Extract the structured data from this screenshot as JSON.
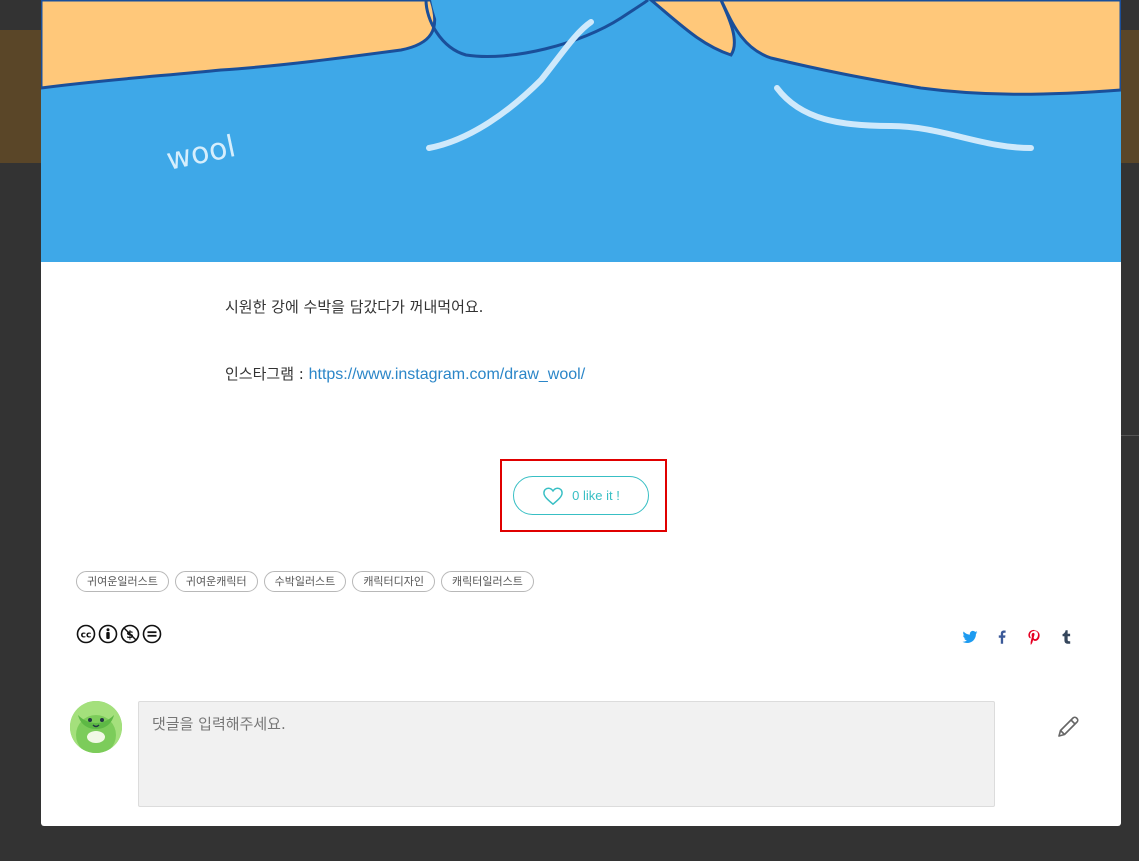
{
  "post": {
    "description": "시원한 강에 수박을 담갔다가 꺼내먹어요.",
    "instagram_label": "인스타그램 : ",
    "instagram_url": "https://www.instagram.com/draw_wool/",
    "artwork_signature": "wool"
  },
  "like": {
    "label": "0 like it !",
    "icon": "heart-outline-icon"
  },
  "tags": [
    "귀여운일러스트",
    "귀여운캐릭터",
    "수박일러스트",
    "캐릭터디자인",
    "캐릭터일러스트"
  ],
  "license": {
    "icons": [
      "cc-icon",
      "by-icon",
      "nc-icon",
      "nd-icon"
    ]
  },
  "share": {
    "icons": [
      "twitter-icon",
      "facebook-icon",
      "pinterest-icon",
      "tumblr-icon"
    ],
    "colors": {
      "twitter": "#1d9bf0",
      "facebook": "#3b5998",
      "pinterest": "#e60023",
      "tumblr": "#35465c"
    }
  },
  "comment": {
    "placeholder": "댓글을 입력해주세요.",
    "submit_icon": "pencil-icon"
  },
  "colors": {
    "accent": "#38bfc4",
    "highlight": "#e00000",
    "link": "#2b86c8",
    "water": "#3ea8e8",
    "sand": "#ffc87a"
  }
}
